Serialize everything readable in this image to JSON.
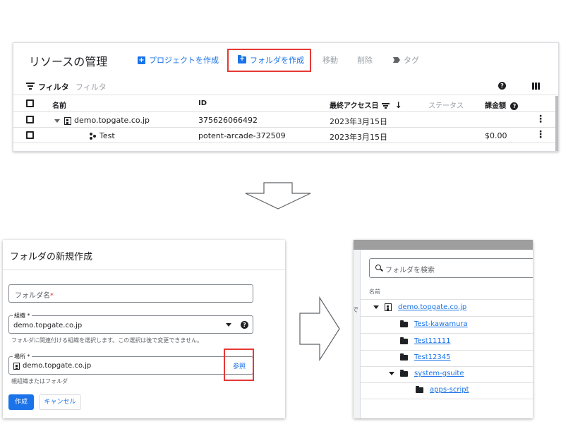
{
  "resource_manager": {
    "title": "リソースの管理",
    "toolbar": {
      "create_project": "プロジェクトを作成",
      "create_folder": "フォルダを作成",
      "move": "移動",
      "delete": "削除",
      "tags": "タグ"
    },
    "filter": {
      "label": "フィルタ",
      "placeholder": "フィルタ"
    },
    "columns": {
      "name": "名前",
      "id": "ID",
      "last_access": "最終アクセス日",
      "status": "ステータス",
      "billing": "課金額"
    },
    "rows": [
      {
        "name": "demo.topgate.co.jp",
        "id": "375626066492",
        "date": "2023年3月15日",
        "billing": ""
      },
      {
        "name": "Test",
        "id": "potent-arcade-372509",
        "date": "2023年3月15日",
        "billing": "$0.00"
      }
    ],
    "menu_glyph": "⋮"
  },
  "new_folder_dialog": {
    "title": "フォルダの新規作成",
    "folder_name_label": "フォルダ名",
    "required_mark": "*",
    "org_label": "組織 *",
    "org_value": "demo.topgate.co.jp",
    "org_hint": "フォルダに関連付ける組織を選択します。この選択は後で変更できません。",
    "location_label": "場所 *",
    "location_value": "demo.topgate.co.jp",
    "browse": "参照",
    "location_hint": "親組織またはフォルダ",
    "create_button": "作成",
    "cancel_button": "キャンセル"
  },
  "folder_browser": {
    "search_placeholder": "フォルダを検索",
    "column_name": "名前",
    "cutoff_text": "で",
    "root": "demo.topgate.co.jp",
    "folders": [
      "Test-kawamura",
      "Test11111",
      "Test12345",
      "system-gsuite"
    ],
    "subfolder": "apps-script"
  },
  "accent_colors": {
    "blue": "#1a73e8",
    "highlight_red": "#e53935"
  }
}
